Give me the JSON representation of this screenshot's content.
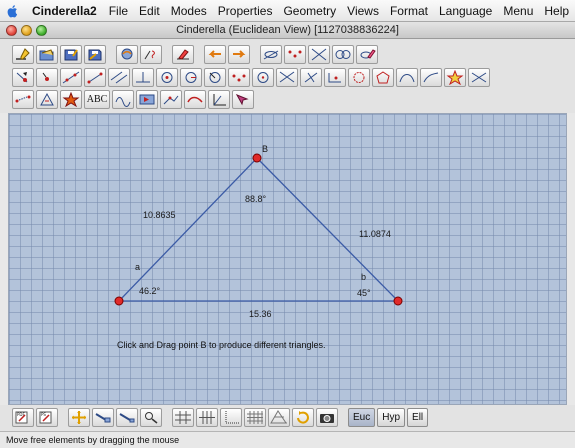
{
  "menubar": {
    "app_name": "Cinderella2",
    "menus": [
      "File",
      "Edit",
      "Modes",
      "Properties",
      "Geometry",
      "Views",
      "Format",
      "Language",
      "Menu",
      "Help"
    ]
  },
  "window": {
    "title": "Cinderella (Euclidean View) [1127038836224]"
  },
  "toolbars": {
    "row1": [
      "new-icon",
      "open-icon",
      "save-icon",
      "save-as-icon",
      "print-icon",
      "edit-icon",
      "draw-icon",
      "undo-icon",
      "redo-icon",
      "hide-icon",
      "show-points-icon",
      "hide-lines-icon",
      "show-circles-icon",
      "eraser-icon"
    ],
    "row2": [
      "move-icon",
      "add-point-icon",
      "add-line-icon",
      "add-segment-icon",
      "parallel-icon",
      "perpendicular-icon",
      "circle-center-icon",
      "circle-radius-icon",
      "compass-icon",
      "circle-three-points-icon",
      "midpoint-icon",
      "angle-bisector-icon",
      "intersection-icon",
      "conic-icon",
      "polygon-icon",
      "arc-icon",
      "locus-icon",
      "ellipse-icon",
      "star-icon",
      "line-through-icon"
    ],
    "row3": [
      "distance-icon",
      "angle-measure-icon",
      "area-icon",
      "text-label",
      "polar-icon",
      "animation-icon",
      "reflection-icon",
      "transform-icon",
      "coordinates-icon",
      "select-icon"
    ],
    "text_tool_label": "ABC"
  },
  "canvas": {
    "points": [
      {
        "name": "A",
        "label": ""
      },
      {
        "name": "B",
        "label": "B"
      },
      {
        "name": "C",
        "label": ""
      }
    ],
    "sides": [
      {
        "name": "a",
        "label": "a",
        "length": "10.8635"
      },
      {
        "name": "b",
        "label": "b",
        "length": "11.0874"
      },
      {
        "name": "c",
        "label": "",
        "length": "15.36"
      }
    ],
    "angles": {
      "A": "46.2°",
      "B": "88.8°",
      "C": "45°"
    },
    "instruction": "Click and Drag point B to produce different triangles."
  },
  "bottombar": {
    "buttons": [
      "pdf-icon",
      "ps-icon",
      "move-view-icon",
      "zoom-in-icon",
      "zoom-out-icon",
      "magnifier-icon",
      "grid-icon",
      "snap-grid-icon",
      "axes-icon",
      "fine-grid-icon",
      "triangle-grid-icon",
      "rotate-icon",
      "screenshot-icon"
    ],
    "geometry_modes": [
      "Euc",
      "Hyp",
      "Ell"
    ],
    "active_mode": "Euc"
  },
  "status": {
    "text": "Move free elements by dragging the mouse"
  },
  "colors": {
    "canvas_bg": "#b3c3da",
    "line": "#3b5ba6",
    "point_fill": "#e02a2a",
    "point_stroke": "#7a0000"
  }
}
